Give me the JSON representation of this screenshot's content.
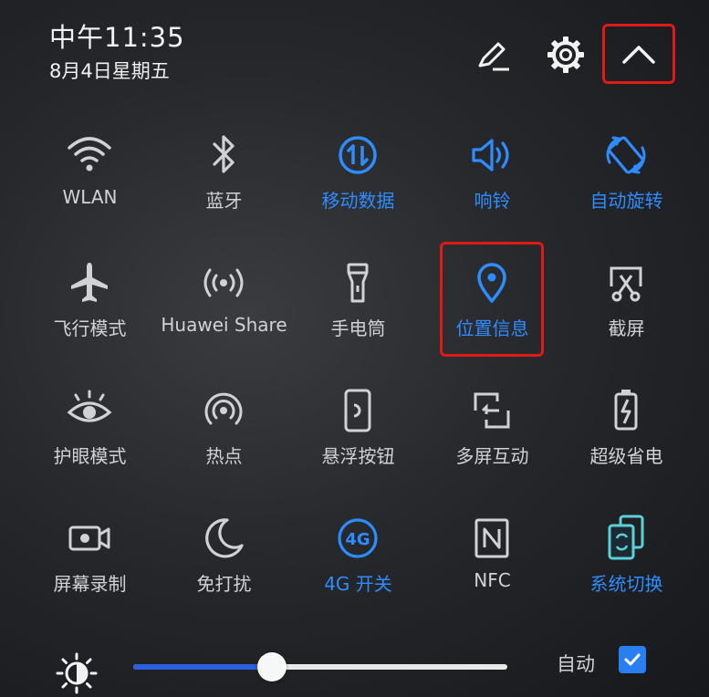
{
  "status": {
    "time": "中午11:35",
    "date": "8月4日星期五"
  },
  "header": {
    "edit_icon": "pencil-edit-icon",
    "settings_icon": "gear-icon",
    "collapse_icon": "chevron-up-icon"
  },
  "colors": {
    "active": "#2f8cff",
    "inactive": "#d0d2d6",
    "highlight": "#e01919",
    "slider_fill": "#2a5fe0"
  },
  "tiles": [
    {
      "label": "WLAN",
      "icon": "wifi-icon",
      "active": false
    },
    {
      "label": "蓝牙",
      "icon": "bluetooth-icon",
      "active": false
    },
    {
      "label": "移动数据",
      "icon": "mobile-data-icon",
      "active": true
    },
    {
      "label": "响铃",
      "icon": "speaker-icon",
      "active": true
    },
    {
      "label": "自动旋转",
      "icon": "rotate-icon",
      "active": true
    },
    {
      "label": "飞行模式",
      "icon": "airplane-icon",
      "active": false
    },
    {
      "label": "Huawei Share",
      "icon": "share-signal-icon",
      "active": false
    },
    {
      "label": "手电筒",
      "icon": "flashlight-icon",
      "active": false
    },
    {
      "label": "位置信息",
      "icon": "location-pin-icon",
      "active": true
    },
    {
      "label": "截屏",
      "icon": "screenshot-icon",
      "active": false
    },
    {
      "label": "护眼模式",
      "icon": "eye-icon",
      "active": false
    },
    {
      "label": "热点",
      "icon": "hotspot-icon",
      "active": false
    },
    {
      "label": "悬浮按钮",
      "icon": "floating-button-icon",
      "active": false
    },
    {
      "label": "多屏互动",
      "icon": "multi-screen-icon",
      "active": false
    },
    {
      "label": "超级省电",
      "icon": "battery-saver-icon",
      "active": false
    },
    {
      "label": "屏幕录制",
      "icon": "screen-record-icon",
      "active": false
    },
    {
      "label": "免打扰",
      "icon": "moon-icon",
      "active": false
    },
    {
      "label": "4G 开关",
      "icon": "4g-icon",
      "active": true
    },
    {
      "label": "NFC",
      "icon": "nfc-icon",
      "active": false
    },
    {
      "label": "系统切换",
      "icon": "system-switch-icon",
      "active": true
    }
  ],
  "brightness": {
    "icon": "brightness-icon",
    "level": 0.37,
    "auto_label": "自动",
    "auto_checked": true
  }
}
